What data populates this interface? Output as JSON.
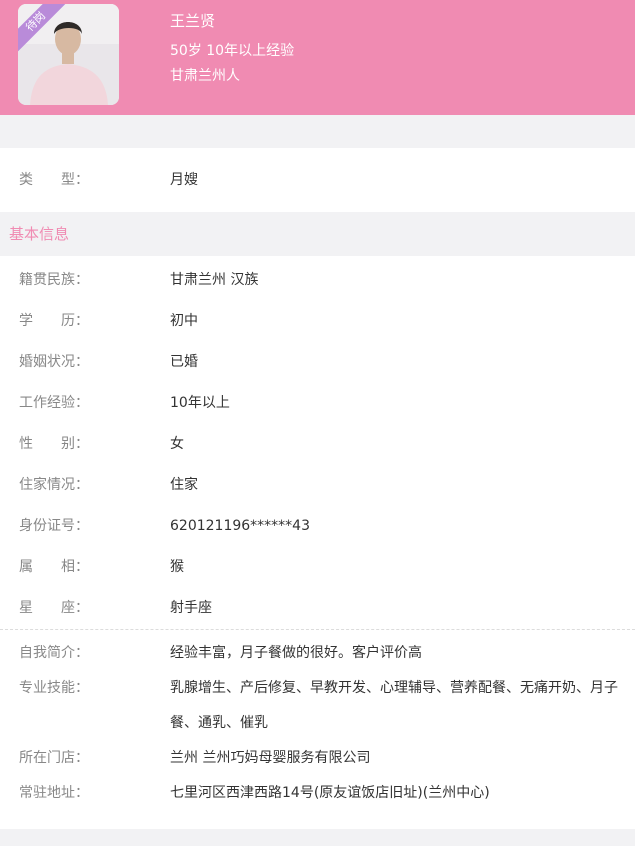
{
  "header": {
    "badge": "待岗",
    "name": "王兰贤",
    "age_experience": "50岁 10年以上经验",
    "origin": "甘肃兰州人"
  },
  "type_row": {
    "label": "类　　型：",
    "value": "月嫂"
  },
  "section_basic": {
    "title": "基本信息"
  },
  "basic_rows": [
    {
      "label": "籍贯民族：",
      "value": "甘肃兰州 汉族"
    },
    {
      "label": "学　　历：",
      "value": "初中"
    },
    {
      "label": "婚姻状况：",
      "value": "已婚"
    },
    {
      "label": "工作经验：",
      "value": "10年以上"
    },
    {
      "label": "性　　别：",
      "value": "女"
    },
    {
      "label": "住家情况：",
      "value": "住家"
    },
    {
      "label": "身份证号：",
      "value": "620121196******43"
    },
    {
      "label": "属　　相：",
      "value": "猴"
    },
    {
      "label": "星　　座：",
      "value": "射手座"
    }
  ],
  "detail_rows": [
    {
      "label": "自我简介：",
      "value": "经验丰富，月子餐做的很好。客户评价高"
    },
    {
      "label": "专业技能：",
      "value": "乳腺增生、产后修复、早教开发、心理辅导、营养配餐、无痛开奶、月子餐、通乳、催乳"
    },
    {
      "label": "所在门店：",
      "value": "兰州 兰州巧妈母婴服务有限公司"
    },
    {
      "label": "常驻地址：",
      "value": "七里河区西津西路14号(原友谊饭店旧址)(兰州中心)"
    }
  ]
}
